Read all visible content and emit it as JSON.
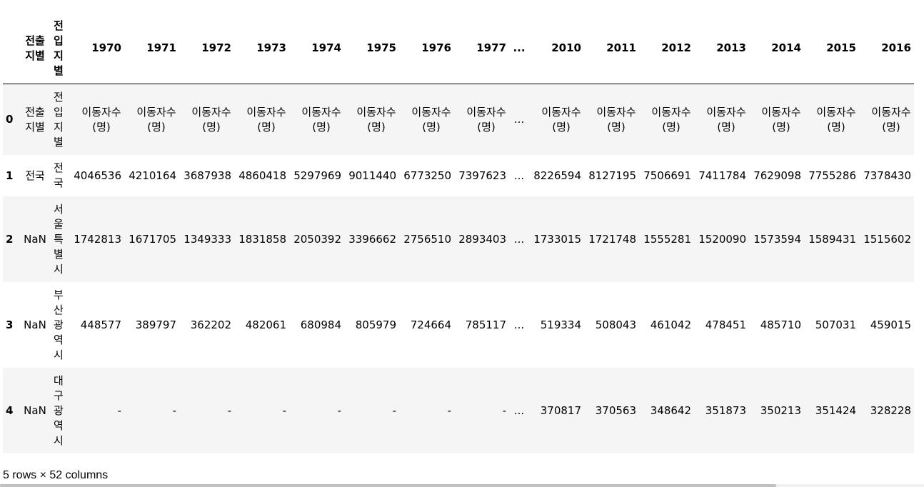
{
  "table": {
    "header": {
      "index": "",
      "out_col": "전출지별",
      "in_col": "전입지별",
      "years_left": [
        "1970",
        "1971",
        "1972",
        "1973",
        "1974",
        "1975",
        "1976",
        "1977"
      ],
      "ellipsis": "...",
      "years_right": [
        "2010",
        "2011",
        "2012",
        "2013",
        "2014",
        "2015",
        "2016"
      ]
    },
    "rows": [
      {
        "index": "0",
        "out": "전출지별",
        "in": "전입지별",
        "left": [
          "이동자수 (명)",
          "이동자수 (명)",
          "이동자수 (명)",
          "이동자수 (명)",
          "이동자수 (명)",
          "이동자수 (명)",
          "이동자수 (명)",
          "이동자수 (명)"
        ],
        "ellipsis": "...",
        "right": [
          "이동자수 (명)",
          "이동자수 (명)",
          "이동자수 (명)",
          "이동자수 (명)",
          "이동자수 (명)",
          "이동자수 (명)",
          "이동자수 (명)"
        ]
      },
      {
        "index": "1",
        "out": "전국",
        "in": "전국",
        "left": [
          "4046536",
          "4210164",
          "3687938",
          "4860418",
          "5297969",
          "9011440",
          "6773250",
          "7397623"
        ],
        "ellipsis": "...",
        "right": [
          "8226594",
          "8127195",
          "7506691",
          "7411784",
          "7629098",
          "7755286",
          "7378430"
        ]
      },
      {
        "index": "2",
        "out": "NaN",
        "in": "서울특별시",
        "left": [
          "1742813",
          "1671705",
          "1349333",
          "1831858",
          "2050392",
          "3396662",
          "2756510",
          "2893403"
        ],
        "ellipsis": "...",
        "right": [
          "1733015",
          "1721748",
          "1555281",
          "1520090",
          "1573594",
          "1589431",
          "1515602"
        ]
      },
      {
        "index": "3",
        "out": "NaN",
        "in": "부산광역시",
        "left": [
          "448577",
          "389797",
          "362202",
          "482061",
          "680984",
          "805979",
          "724664",
          "785117"
        ],
        "ellipsis": "...",
        "right": [
          "519334",
          "508043",
          "461042",
          "478451",
          "485710",
          "507031",
          "459015"
        ]
      },
      {
        "index": "4",
        "out": "NaN",
        "in": "대구광역시",
        "left": [
          "-",
          "-",
          "-",
          "-",
          "-",
          "-",
          "-",
          "-"
        ],
        "ellipsis": "...",
        "right": [
          "370817",
          "370563",
          "348642",
          "351873",
          "350213",
          "351424",
          "328228"
        ]
      }
    ]
  },
  "footer": {
    "shape_text": "5 rows × 52 columns"
  }
}
